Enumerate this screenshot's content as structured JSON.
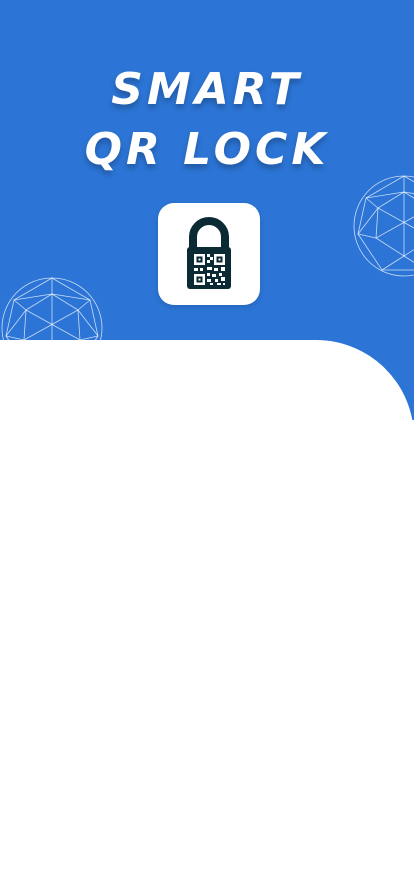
{
  "title_line1": "SMART",
  "title_line2": "QR LOCK",
  "colors": {
    "hero_background": "#2c75d6",
    "sheet_background": "#ffffff",
    "lock": "#0b2a33"
  },
  "icons": {
    "logo": "qr-padlock-icon",
    "decor": "wireframe-globe-icon"
  }
}
